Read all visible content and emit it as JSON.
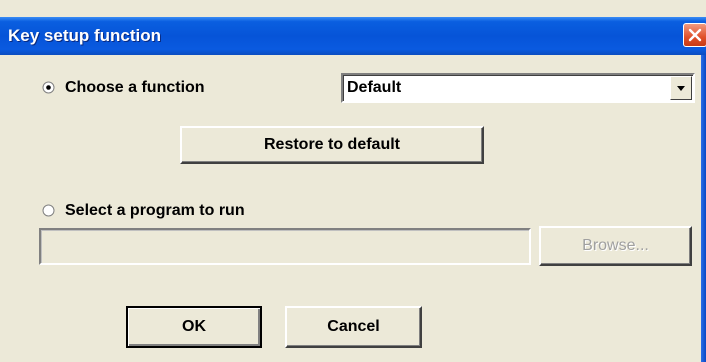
{
  "window": {
    "title": "Key setup function"
  },
  "function_option": {
    "label": "Choose a function",
    "selected": true,
    "dropdown": {
      "value": "Default"
    },
    "restore_button_label": "Restore to default"
  },
  "program_option": {
    "label": "Select a program to run",
    "selected": false,
    "path_value": "",
    "browse_button_label": "Browse...",
    "browse_enabled": false
  },
  "footer": {
    "ok_label": "OK",
    "cancel_label": "Cancel"
  },
  "icons": {
    "close": "close-icon",
    "dropdown": "chevron-down-icon",
    "radio_selected": "radio-selected-icon",
    "radio_unselected": "radio-unselected-icon"
  },
  "colors": {
    "title_bar": "#0654d8",
    "dialog_background": "#ece9d8",
    "close_button": "#e0502a"
  }
}
